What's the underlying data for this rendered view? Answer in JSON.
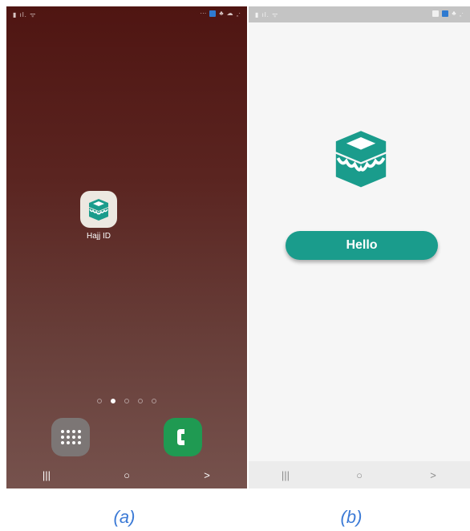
{
  "screen_a": {
    "app": {
      "label": "Hajj ID",
      "icon": "kaaba-icon"
    },
    "page_dots": {
      "count": 5,
      "active": 1
    },
    "dock": [
      {
        "name": "apps-grid-icon"
      },
      {
        "name": "phone-icon"
      }
    ],
    "nav": {
      "recents": "|||",
      "home": "○",
      "back": ">"
    }
  },
  "screen_b": {
    "button": {
      "label": "Hello"
    },
    "nav": {
      "recents": "|||",
      "home": "○",
      "back": ">"
    },
    "accent": "#1a9c8c"
  },
  "captions": {
    "a": "(a)",
    "b": "(b)"
  }
}
